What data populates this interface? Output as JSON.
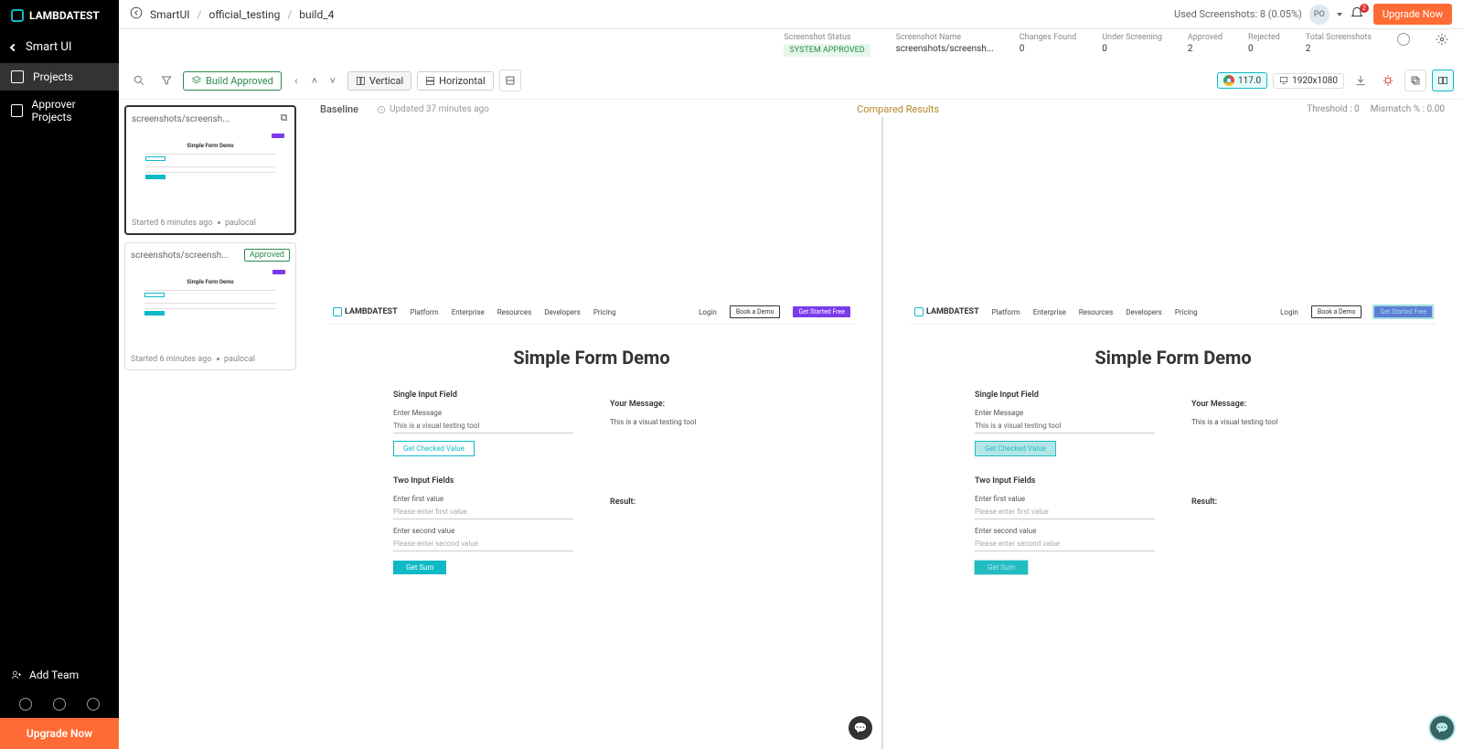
{
  "brand": "LAMBDATEST",
  "sidebar": {
    "back": "Smart UI",
    "items": [
      {
        "label": "Projects",
        "active": true
      },
      {
        "label": "Approver Projects",
        "active": false
      }
    ],
    "add_team": "Add Team",
    "upgrade": "Upgrade Now"
  },
  "breadcrumb": {
    "root": "SmartUI",
    "project": "official_testing",
    "build": "build_4"
  },
  "header": {
    "used_screenshots": "Used Screenshots: 8 (0.05%)",
    "avatar": "PO",
    "notif_count": "2",
    "upgrade": "Upgrade Now"
  },
  "info": {
    "status_label": "Screenshot Status",
    "status_value": "SYSTEM APPROVED",
    "name_label": "Screenshot Name",
    "name_value": "screenshots/screensh...",
    "changes_label": "Changes Found",
    "changes_value": "0",
    "screening_label": "Under Screening",
    "screening_value": "0",
    "approved_label": "Approved",
    "approved_value": "2",
    "rejected_label": "Rejected",
    "rejected_value": "0",
    "total_label": "Total Screenshots",
    "total_value": "2"
  },
  "toolbar": {
    "build_approved": "Build Approved",
    "vertical": "Vertical",
    "horizontal": "Horizontal",
    "browser_version": "117.0",
    "resolution": "1920x1080"
  },
  "compare": {
    "baseline": "Baseline",
    "updated": "Updated 37 minutes ago",
    "compared": "Compared Results",
    "threshold": "Threshold : 0",
    "mismatch": "Mismatch % : 0.00"
  },
  "thumbs": [
    {
      "name": "screenshots/screensh...",
      "started": "Started 6 minutes ago",
      "author": "paulocal",
      "approved_badge": "",
      "selected": true
    },
    {
      "name": "screenshots/screensh...",
      "started": "Started 6 minutes ago",
      "author": "paulocal",
      "approved_badge": "Approved",
      "selected": false
    }
  ],
  "mock": {
    "nav": [
      "Platform",
      "Enterprise",
      "Resources",
      "Developers",
      "Pricing"
    ],
    "login": "Login",
    "book": "Book a Demo",
    "cta": "Get Started Free",
    "title": "Simple Form Demo",
    "sec1": "Single Input Field",
    "msg_lbl": "Enter Message",
    "msg_val": "This is a visual testing tool",
    "check_btn": "Get Checked Value",
    "your_msg": "Your Message:",
    "your_msg_val": "This is a visual testing tool",
    "sec2": "Two Input Fields",
    "f1_lbl": "Enter first value",
    "f1_ph": "Please enter first value",
    "f2_lbl": "Enter second value",
    "f2_ph": "Please enter second value",
    "sum_btn": "Get Sum",
    "result": "Result:"
  }
}
